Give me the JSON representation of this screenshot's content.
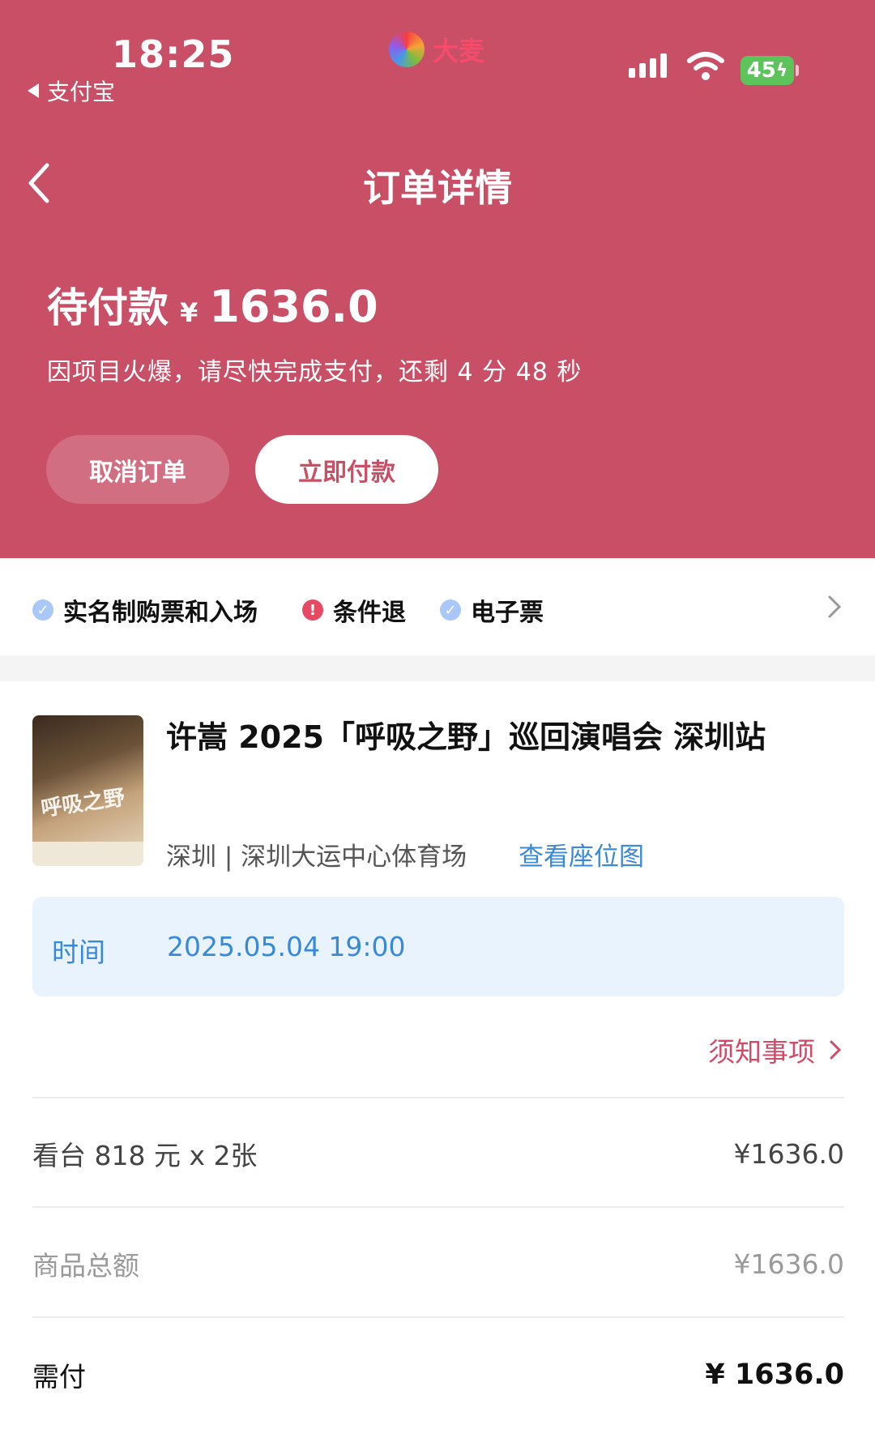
{
  "status_bar": {
    "time": "18:25",
    "back_app": "支付宝",
    "brand": "大麦",
    "battery": "45"
  },
  "nav": {
    "title": "订单详情"
  },
  "payment": {
    "status_label": "待付款",
    "currency": "¥",
    "amount": "1636.0",
    "subtitle": "因项目火爆，请尽快完成支付，还剩 4 分 48 秒",
    "cancel_label": "取消订单",
    "pay_label": "立即付款"
  },
  "policies": [
    {
      "label": "实名制购票和入场",
      "icon": "check-icon"
    },
    {
      "label": "条件退",
      "icon": "warning-icon"
    },
    {
      "label": "电子票",
      "icon": "check-icon"
    }
  ],
  "event": {
    "title": "许嵩 2025「呼吸之野」巡回演唱会 深圳站",
    "venue": "深圳 | 深圳大运中心体育场",
    "seat_map_link": "查看座位图",
    "poster_text": "呼吸之野",
    "time_label": "时间",
    "time_value": "2025.05.04 19:00",
    "notice_link": "须知事项"
  },
  "price_rows": {
    "ticket_label": "看台 818 元 x 2张",
    "ticket_value": "¥1636.0",
    "subtotal_label": "商品总额",
    "subtotal_value": "¥1636.0",
    "due_label": "需付",
    "due_value": "¥ 1636.0"
  },
  "colors": {
    "header_bg": "#c94f66",
    "link_blue": "#3a89d8",
    "notice_red": "#d24a68"
  }
}
